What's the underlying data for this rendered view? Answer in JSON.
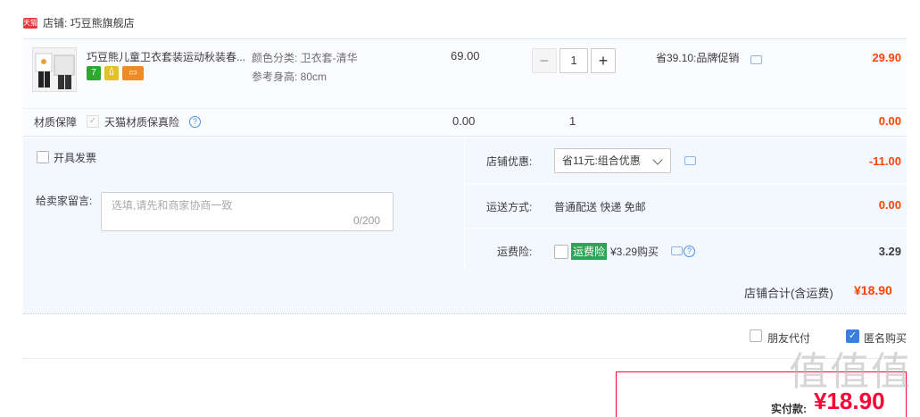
{
  "shop": {
    "badge": "天猫",
    "label": "店铺: 巧豆熊旗舰店"
  },
  "item": {
    "title": "巧豆熊儿童卫衣套装运动秋装春...",
    "tags": [
      "7",
      "ů",
      "▭"
    ],
    "sku_color": "颜色分类: 卫衣套-清华",
    "sku_height": "参考身高: 80cm",
    "unit_price": "69.00",
    "qty_minus": "−",
    "quantity": "1",
    "qty_plus": "+",
    "promo": "省39.10:品牌促销",
    "subtotal": "29.90"
  },
  "insurance": {
    "label": "材质保障",
    "option": "天猫材质保真险",
    "price": "0.00",
    "qty": "1",
    "subtotal": "0.00"
  },
  "order": {
    "invoice": "开具发票",
    "note_label": "给卖家留言:",
    "note_placeholder": "选填,请先和商家协商一致",
    "note_count": "0/200",
    "discount_label": "店铺优惠:",
    "discount_selected": "省11元:组合优惠",
    "discount_value": "-11.00",
    "shipping_label": "运送方式:",
    "shipping_value": "普通配送 快递 免邮",
    "shipping_cost": "0.00",
    "freight_ins_label": "运费险:",
    "freight_ins_name": "运费险",
    "freight_ins_price": "¥3.29购买",
    "freight_ins_value": "3.29",
    "total_label": "店铺合计(含运费)",
    "total_value": "¥18.90"
  },
  "options": {
    "friend_pay": "朋友代付",
    "anonymous": "匿名购买"
  },
  "payment": {
    "label": "实付款:",
    "value": "¥18.90"
  },
  "watermark": "值值值"
}
